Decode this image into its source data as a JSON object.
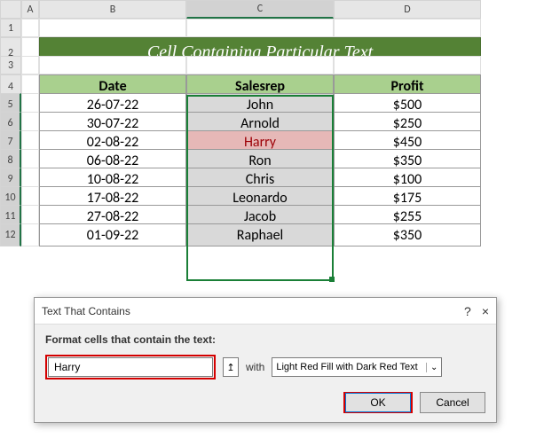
{
  "columns": [
    "A",
    "B",
    "C",
    "D"
  ],
  "rows": [
    "1",
    "2",
    "3",
    "4",
    "5",
    "6",
    "7",
    "8",
    "9",
    "10",
    "11",
    "12"
  ],
  "title": "Cell Containing Particular Text",
  "headers": {
    "date": "Date",
    "salesrep": "Salesrep",
    "profit": "Profit"
  },
  "data": [
    {
      "date": "26-07-22",
      "salesrep": "John",
      "profit": "$500"
    },
    {
      "date": "30-07-22",
      "salesrep": "Arnold",
      "profit": "$250"
    },
    {
      "date": "02-08-22",
      "salesrep": "Harry",
      "profit": "$450"
    },
    {
      "date": "06-08-22",
      "salesrep": "Ron",
      "profit": "$350"
    },
    {
      "date": "10-08-22",
      "salesrep": "Chris",
      "profit": "$100"
    },
    {
      "date": "17-08-22",
      "salesrep": "Leonardo",
      "profit": "$175"
    },
    {
      "date": "27-08-22",
      "salesrep": "Jacob",
      "profit": "$255"
    },
    {
      "date": "01-09-22",
      "salesrep": "Raphael",
      "profit": "$350"
    }
  ],
  "dialog": {
    "title": "Text That Contains",
    "label": "Format cells that contain the text:",
    "input_value": "Harry",
    "with_label": "with",
    "format_option": "Light Red Fill with Dark Red Text",
    "ok": "OK",
    "cancel": "Cancel",
    "help": "?",
    "close": "×"
  },
  "chart_data": {
    "type": "table",
    "title": "Cell Containing Particular Text",
    "columns": [
      "Date",
      "Salesrep",
      "Profit"
    ],
    "rows": [
      [
        "26-07-22",
        "John",
        500
      ],
      [
        "30-07-22",
        "Arnold",
        250
      ],
      [
        "02-08-22",
        "Harry",
        450
      ],
      [
        "06-08-22",
        "Ron",
        350
      ],
      [
        "10-08-22",
        "Chris",
        100
      ],
      [
        "17-08-22",
        "Leonardo",
        175
      ],
      [
        "27-08-22",
        "Jacob",
        255
      ],
      [
        "01-09-22",
        "Raphael",
        350
      ]
    ]
  }
}
